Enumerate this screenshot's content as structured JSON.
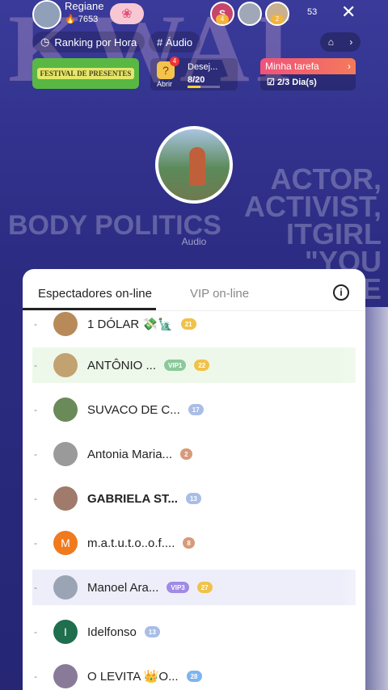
{
  "header": {
    "host_name": "Regiane",
    "host_likes": "7653",
    "viewer_avatars": [
      {
        "letter": "S",
        "color": "#c7446a",
        "badge": "4"
      },
      {
        "letter": "",
        "color": "#a0a8b8",
        "badge": ""
      },
      {
        "letter": "",
        "color": "#c8b090",
        "badge": "2"
      }
    ],
    "viewer_count": "53",
    "close_label": "✕"
  },
  "nav": {
    "ranking_label": "Ranking por Hora",
    "audio_tag": "# Áudio",
    "home_icon": "⌂",
    "arrow": "›"
  },
  "banners": {
    "festival_label": "FESTIVAL DE PRESENTES",
    "gift_badge": "4",
    "abrir": "Abrir",
    "desejo": "Desej...",
    "progress_text": "8/20",
    "progress_fraction": 0.4,
    "mytask_label": "Minha tarefa",
    "mytask_days": "2/3 Dia(s)"
  },
  "watermark": {
    "top": "KWAI",
    "right_text": "ACTOR, ACTIVIST, ITGIRL \"YOU HAVE THE",
    "left_text": "BODY POLITICS"
  },
  "stream": {
    "audio_label": "Audio"
  },
  "sheet": {
    "tab_active": "Espectadores on-line",
    "tab_inactive": "VIP on-line",
    "info_icon": "i",
    "rows": [
      {
        "name": "1 DÓLAR 💸🗽",
        "bold": false,
        "avatar_color": "#b88a5a",
        "avatar_letter": "",
        "highlight": "",
        "badges": [
          {
            "cls": "b-gold",
            "text": "21"
          }
        ]
      },
      {
        "name": "ANTÔNIO ...",
        "bold": false,
        "avatar_color": "#c2a270",
        "avatar_letter": "",
        "highlight": "hl-green",
        "badges": [
          {
            "cls": "b-vip1",
            "text": "VIP1"
          },
          {
            "cls": "b-gold",
            "text": "22"
          }
        ]
      },
      {
        "name": "SUVACO DE C...",
        "bold": false,
        "avatar_color": "#6a8a5a",
        "avatar_letter": "",
        "highlight": "",
        "badges": [
          {
            "cls": "b-blue",
            "text": "17"
          }
        ]
      },
      {
        "name": "Antonia Maria...",
        "bold": false,
        "avatar_color": "#9a9a9a",
        "avatar_letter": "",
        "highlight": "",
        "badges": [
          {
            "cls": "b-brown",
            "text": "2"
          }
        ]
      },
      {
        "name": "GABRIELA ST...",
        "bold": true,
        "avatar_color": "#a07a6a",
        "avatar_letter": "",
        "highlight": "",
        "badges": [
          {
            "cls": "b-blue",
            "text": "13"
          }
        ]
      },
      {
        "name": "m.a.t.u.t.o..o.f....",
        "bold": false,
        "avatar_color": "#f07a1e",
        "avatar_letter": "M",
        "highlight": "",
        "badges": [
          {
            "cls": "b-brown",
            "text": "8"
          }
        ]
      },
      {
        "name": "Manoel Ara...",
        "bold": false,
        "avatar_color": "#9aa4b4",
        "avatar_letter": "",
        "highlight": "hl-purple",
        "badges": [
          {
            "cls": "b-vip3",
            "text": "VIP3"
          },
          {
            "cls": "b-gold",
            "text": "27"
          }
        ]
      },
      {
        "name": "Idelfonso",
        "bold": false,
        "avatar_color": "#1f6e4e",
        "avatar_letter": "I",
        "highlight": "",
        "badges": [
          {
            "cls": "b-blue",
            "text": "13"
          }
        ]
      },
      {
        "name": "O LEVITA 👑O...",
        "bold": false,
        "avatar_color": "#8a7a9a",
        "avatar_letter": "",
        "highlight": "",
        "badges": [
          {
            "cls": "b-cyan",
            "text": "28"
          }
        ]
      }
    ]
  }
}
